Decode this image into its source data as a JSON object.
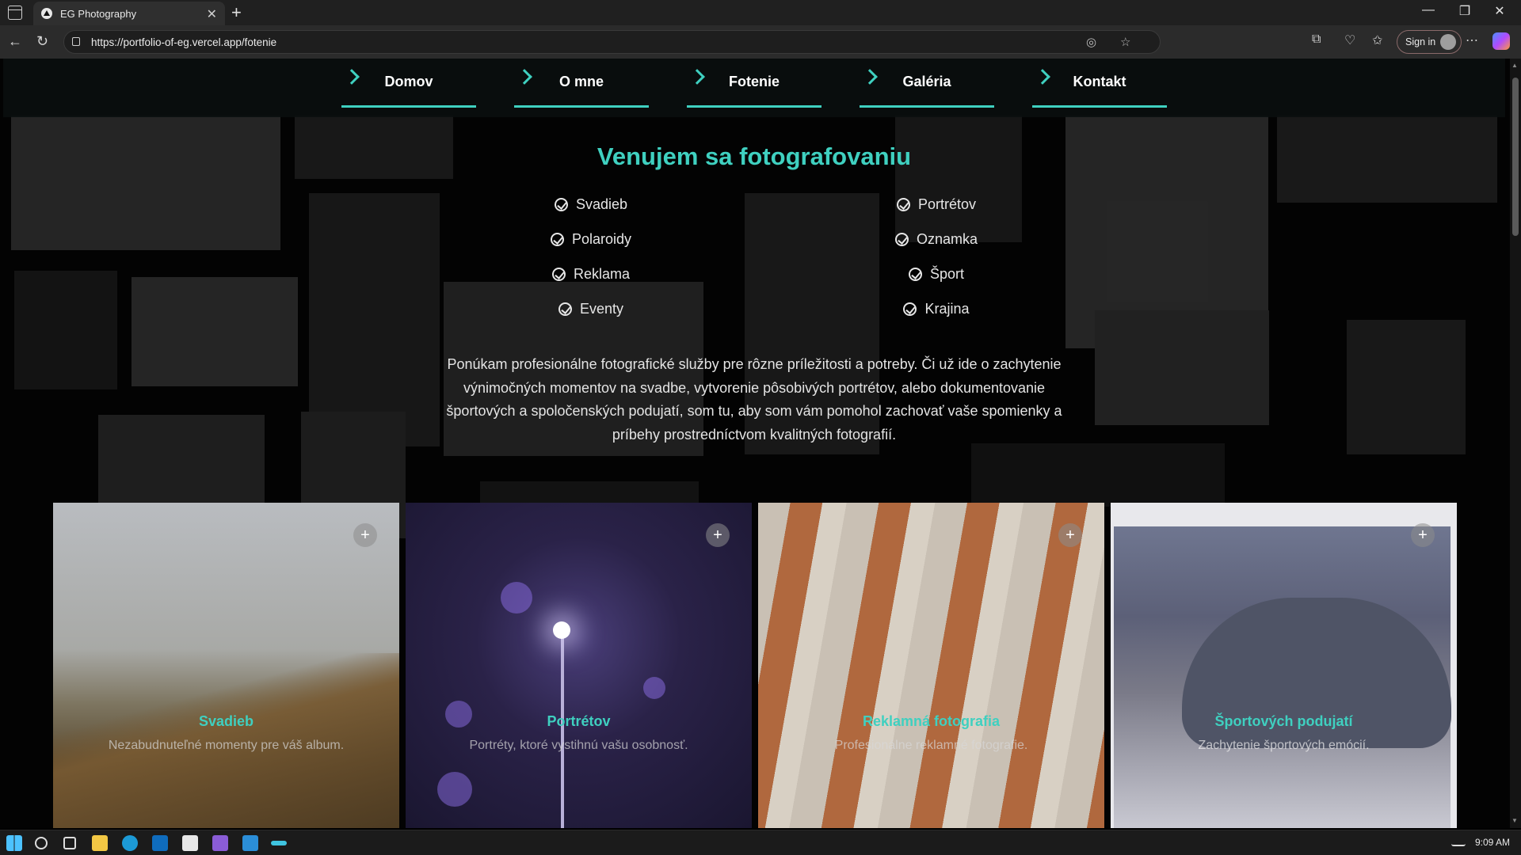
{
  "browser": {
    "tab_title": "EG Photography",
    "tab_close": "✕",
    "new_tab": "+",
    "url": "https://portfolio-of-eg.vercel.app/fotenie",
    "sign_in": "Sign in",
    "back": "←",
    "reload": "↻",
    "more": "⋯",
    "minimize": "—",
    "restore": "❐",
    "close": "✕"
  },
  "nav": [
    {
      "label": "Domov"
    },
    {
      "label": "O mne"
    },
    {
      "label": "Fotenie"
    },
    {
      "label": "Galéria"
    },
    {
      "label": "Kontakt"
    }
  ],
  "heading": "Venujem sa fotografovaniu",
  "services_left": [
    "Svadieb",
    "Polaroidy",
    "Reklama",
    "Eventy"
  ],
  "services_right": [
    "Portrétov",
    "Oznamka",
    "Šport",
    "Krajina"
  ],
  "intro": "Ponúkam profesionálne fotografické služby pre rôzne príležitosti a potreby. Či už ide o zachytenie výnimočných momentov na svadbe, vytvorenie pôsobivých portrétov, alebo dokumentovanie športových a spoločenských podujatí, som tu, aby som vám pomohol zachovať vaše spomienky a príbehy prostredníctvom kvalitných fotografií.",
  "cards": [
    {
      "title": "Svadieb",
      "subtitle": "Nezabudnuteľné momenty pre váš album.",
      "plus": "+"
    },
    {
      "title": "Portrétov",
      "subtitle": "Portréty, ktoré vystihnú vašu osobnosť.",
      "plus": "+"
    },
    {
      "title": "Reklamná fotografia",
      "subtitle": "Profesionálne reklamné fotografie.",
      "plus": "+"
    },
    {
      "title": "Športových podujatí",
      "subtitle": "Zachytenie športových emócií.",
      "plus": "+"
    }
  ],
  "taskbar": {
    "time": "9:09 AM"
  },
  "colors": {
    "accent": "#3fd0c0",
    "background": "#060606"
  }
}
